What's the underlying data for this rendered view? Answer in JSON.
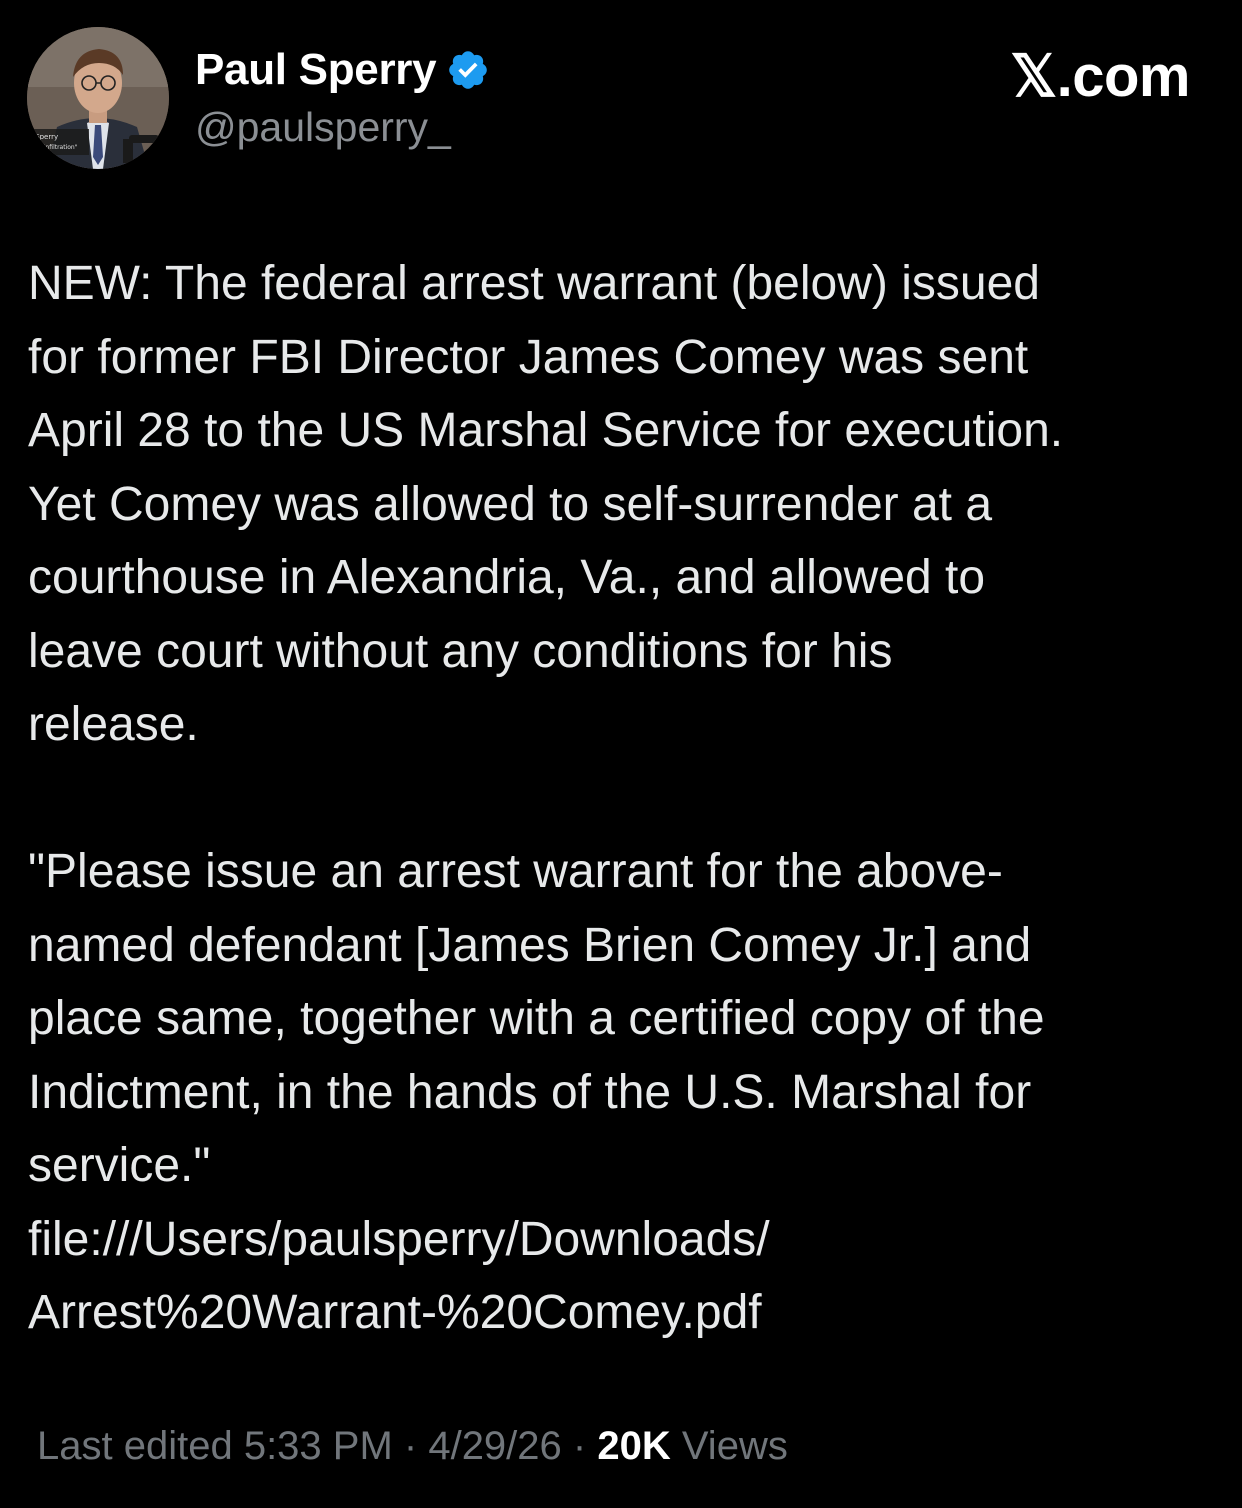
{
  "author": {
    "display_name": "Paul Sperry",
    "handle": "@paulsperry_",
    "verified": true,
    "avatar_caption_lines": [
      "l Sperry",
      "or, \"Infiltration\""
    ]
  },
  "brand": {
    "label": "𝕏.com"
  },
  "tweet": {
    "paragraph_1": "NEW: The federal arrest warrant (below) issued\nfor former FBI Director James Comey was sent\nApril 28 to the US Marshal Service for execution.\nYet Comey was allowed to self-surrender at a\ncourthouse in Alexandria, Va., and allowed to\nleave court without any conditions for his\nrelease.",
    "paragraph_2": "\"Please issue an arrest warrant for the above-\nnamed defendant [James Brien Comey Jr.] and\nplace same, together with a certified copy of the\nIndictment, in the hands of the U.S. Marshal for\nservice.\"",
    "link": "file:///Users/paulsperry/Downloads/\nArrest%20Warrant-%20Comey.pdf"
  },
  "meta": {
    "edited_label": "Last edited 5:33 PM",
    "separator": " · ",
    "date": "4/29/26",
    "separator_2": " · ",
    "views_count": "20K",
    "views_label": " Views"
  },
  "colors": {
    "background": "#000000",
    "text": "#e7e9ea",
    "secondary": "#8b8f94",
    "verified_badge": "#1d9bf0"
  }
}
